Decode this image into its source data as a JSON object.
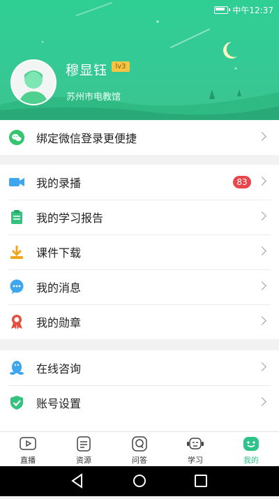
{
  "status_bar": {
    "time": "中午12:37"
  },
  "profile": {
    "name": "穆显钰",
    "level": "lv3",
    "organization": "苏州市电教馆"
  },
  "wechat_section": {
    "label": "绑定微信登录更便捷"
  },
  "menu_main": [
    {
      "label": "我的录播",
      "badge": "83"
    },
    {
      "label": "我的学习报告"
    },
    {
      "label": "课件下载"
    },
    {
      "label": "我的消息"
    },
    {
      "label": "我的勋章"
    }
  ],
  "menu_more": [
    {
      "label": "在线咨询"
    },
    {
      "label": "账号设置"
    }
  ],
  "tabbar": [
    {
      "label": "直播"
    },
    {
      "label": "资源"
    },
    {
      "label": "问答"
    },
    {
      "label": "学习"
    },
    {
      "label": "我的"
    }
  ],
  "colors": {
    "accent": "#2fc38b",
    "badge": "#e8464a"
  }
}
